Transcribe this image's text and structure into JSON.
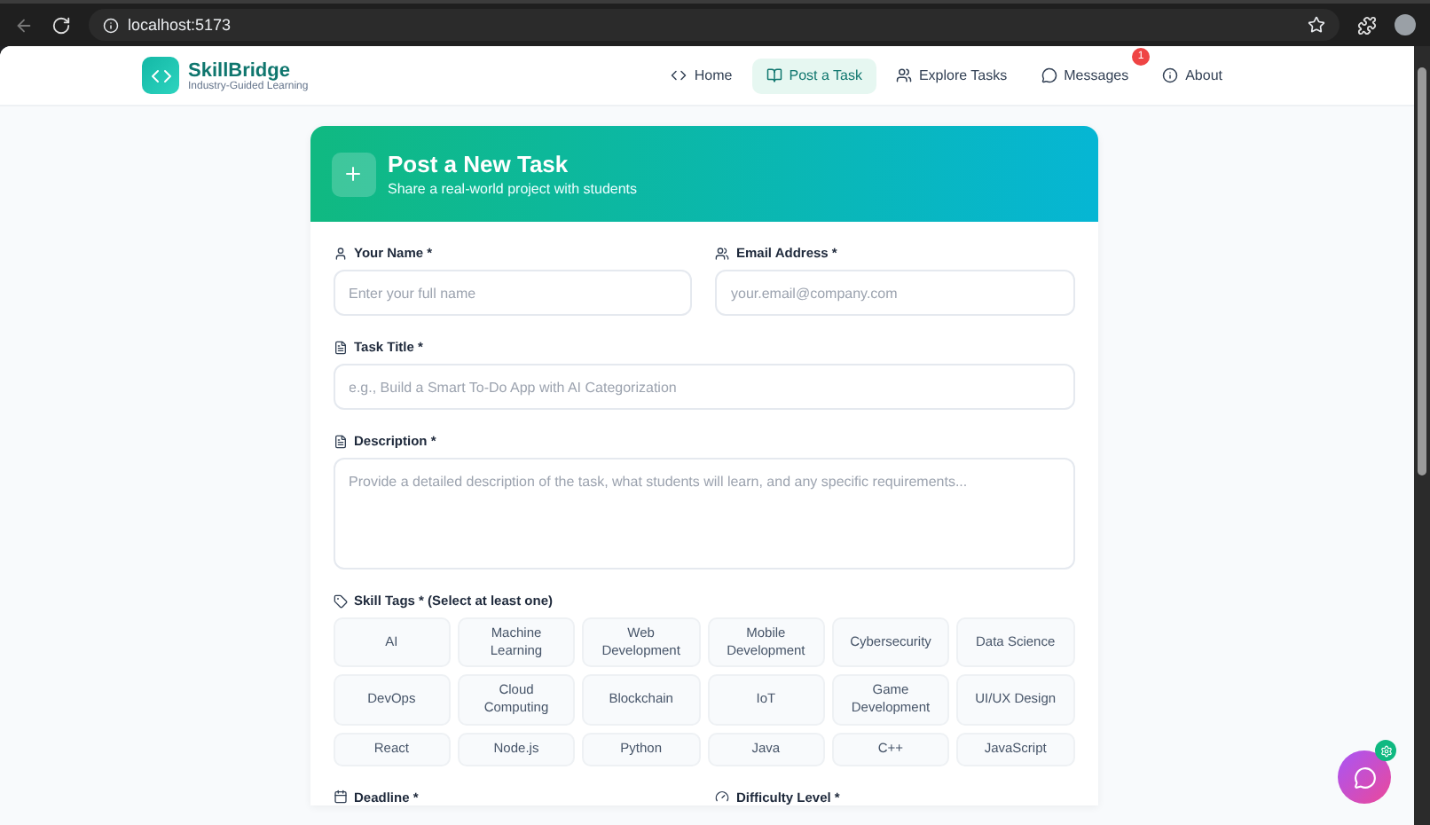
{
  "browser": {
    "url": "localhost:5173"
  },
  "brand": {
    "name": "SkillBridge",
    "tagline": "Industry-Guided Learning"
  },
  "nav": [
    {
      "label": "Home",
      "kind": "home",
      "selected": false
    },
    {
      "label": "Post a Task",
      "kind": "post",
      "selected": true
    },
    {
      "label": "Explore Tasks",
      "kind": "explore",
      "selected": false
    },
    {
      "label": "Messages",
      "kind": "messages",
      "selected": false,
      "badge": "1"
    },
    {
      "label": "About",
      "kind": "about",
      "selected": false
    }
  ],
  "form": {
    "title": "Post a New Task",
    "subtitle": "Share a real-world project with students",
    "name_field": {
      "label": "Your Name *",
      "placeholder": "Enter your full name"
    },
    "email_field": {
      "label": "Email Address *",
      "placeholder": "your.email@company.com"
    },
    "title_field": {
      "label": "Task Title *",
      "placeholder": "e.g., Build a Smart To-Do App with AI Categorization"
    },
    "description_field": {
      "label": "Description *",
      "placeholder": "Provide a detailed description of the task, what students will learn, and any specific requirements..."
    },
    "skill_tags": {
      "label": "Skill Tags * (Select at least one)",
      "tags": [
        {
          "label": "AI",
          "selected": false
        },
        {
          "label": "Machine Learning",
          "selected": false
        },
        {
          "label": "Web Development",
          "selected": false
        },
        {
          "label": "Mobile Development",
          "selected": false
        },
        {
          "label": "Cybersecurity",
          "selected": false
        },
        {
          "label": "Data Science",
          "selected": false
        },
        {
          "label": "DevOps",
          "selected": false
        },
        {
          "label": "Cloud Computing",
          "selected": false
        },
        {
          "label": "Blockchain",
          "selected": false
        },
        {
          "label": "IoT",
          "selected": false
        },
        {
          "label": "Game Development",
          "selected": false
        },
        {
          "label": "UI/UX Design",
          "selected": false
        },
        {
          "label": "React",
          "selected": false
        },
        {
          "label": "Node.js",
          "selected": false
        },
        {
          "label": "Python",
          "selected": false
        },
        {
          "label": "Java",
          "selected": false
        },
        {
          "label": "C++",
          "selected": false
        },
        {
          "label": "JavaScript",
          "selected": false
        }
      ]
    },
    "deadline_label": "Deadline *",
    "difficulty_label": "Difficulty Level *"
  }
}
